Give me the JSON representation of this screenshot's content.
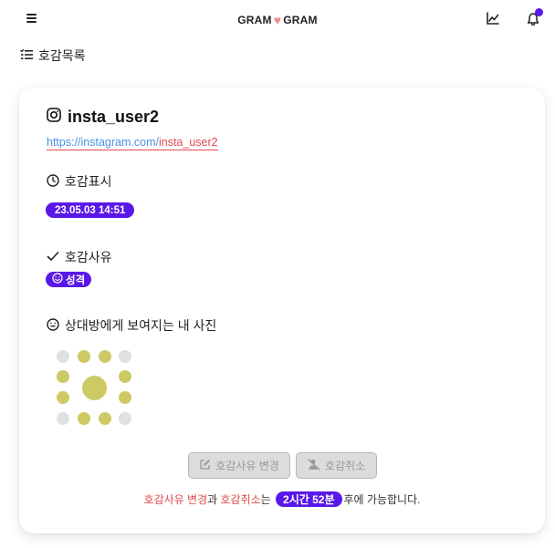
{
  "header": {
    "brand_left": "GRAM",
    "brand_heart": "♥",
    "brand_right": "GRAM",
    "icons": [
      "menu-icon",
      "chart-line-icon",
      "bell-icon"
    ],
    "accent": "#5a18e8"
  },
  "section": {
    "title": "호감목록",
    "icon": "list-icon"
  },
  "card": {
    "username": "insta_user2",
    "username_icon": "instagram-icon",
    "link_base": "https://instagram.com/",
    "link_handle": "insta_user2",
    "time_label": "호감표시",
    "time_icon": "clock-icon",
    "time_value": "23.05.03 14:51",
    "reason_label": "호감사유",
    "reason_icon": "check-icon",
    "reason_value": "성격",
    "reason_value_icon": "smile-icon",
    "photo_label": "상대방에게 보여지는 내 사진",
    "photo_icon": "grin-icon",
    "photo_state": "loading",
    "buttons": {
      "change_label": "호감사유 변경",
      "cancel_label": "호감취소"
    },
    "notice": {
      "part1": "호감사유 변경",
      "part2": "과 ",
      "part3": "호감취소",
      "part4": "는 ",
      "time": "2시간 52분",
      "part5": "후에 가능합니다."
    }
  },
  "colors": {
    "accent": "#5a18e8",
    "link": "#4a90e2",
    "red": "#e24b4b",
    "heart": "#f08a8a",
    "spinner": "#cdca65"
  }
}
